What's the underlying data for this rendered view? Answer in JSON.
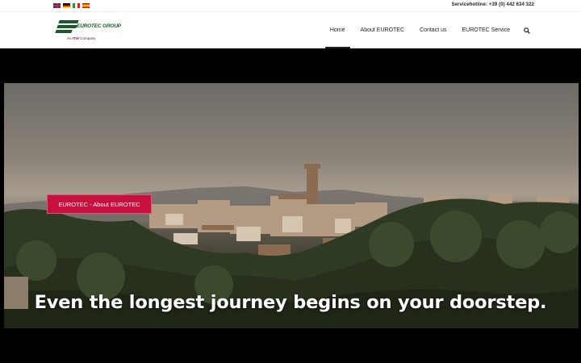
{
  "topbar": {
    "languages": [
      "English",
      "Deutsch",
      "Italiano",
      "Español"
    ],
    "hotline": "Servicehotline: +39 (0) 442 634 322"
  },
  "logo": {
    "name": "EUROTEC GROUP",
    "tagline_prefix": "An",
    "tagline_brand": "ITW",
    "tagline_suffix": "Company",
    "colors": {
      "green": "#1d5a2b",
      "red": "#c8102e"
    }
  },
  "nav": {
    "items": [
      {
        "label": "Home",
        "active": true
      },
      {
        "label": "About EUROTEC",
        "active": false
      },
      {
        "label": "Contact us",
        "active": false
      },
      {
        "label": "EUROTEC Service",
        "active": false
      }
    ],
    "search_icon": "search-icon"
  },
  "hero": {
    "button_label": "EUROTEC - About EUROTEC",
    "button_color": "#c8103f",
    "headline": "Even the longest journey begins on your doorstep."
  }
}
